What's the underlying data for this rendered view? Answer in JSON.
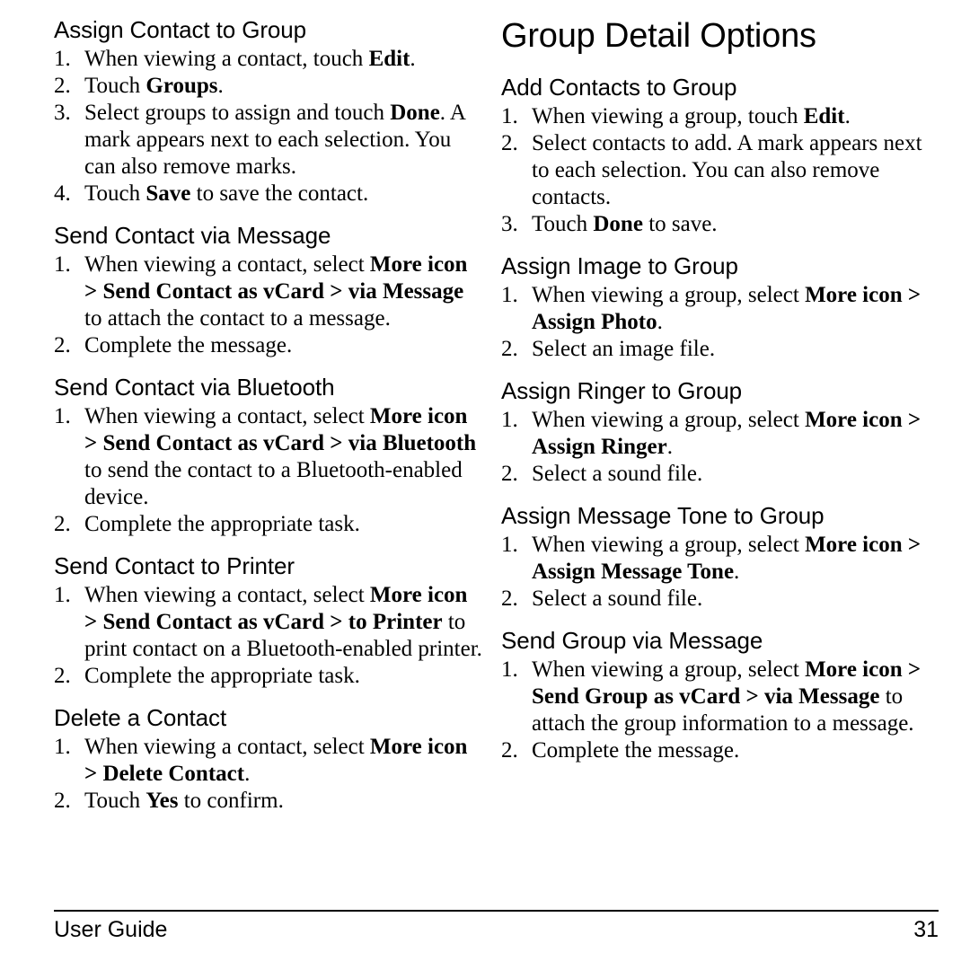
{
  "document": {
    "page_title": "Group Detail Options"
  },
  "left_column": {
    "sections": [
      {
        "heading": "Assign Contact to Group",
        "steps": [
          {
            "num": "1.",
            "parts": [
              {
                "t": "When viewing a contact, touch ",
                "b": false
              },
              {
                "t": "Edit",
                "b": true
              },
              {
                "t": ".",
                "b": false
              }
            ]
          },
          {
            "num": "2.",
            "parts": [
              {
                "t": "Touch ",
                "b": false
              },
              {
                "t": "Groups",
                "b": true
              },
              {
                "t": ".",
                "b": false
              }
            ]
          },
          {
            "num": "3.",
            "parts": [
              {
                "t": "Select groups to assign and touch ",
                "b": false
              },
              {
                "t": "Done",
                "b": true
              },
              {
                "t": ". A mark appears next to each selection. You can also remove marks.",
                "b": false
              }
            ]
          },
          {
            "num": "4.",
            "parts": [
              {
                "t": "Touch ",
                "b": false
              },
              {
                "t": "Save",
                "b": true
              },
              {
                "t": " to save the contact.",
                "b": false
              }
            ]
          }
        ]
      },
      {
        "heading": "Send Contact via Message",
        "steps": [
          {
            "num": "1.",
            "parts": [
              {
                "t": "When viewing a contact, select ",
                "b": false
              },
              {
                "t": "More icon > Send Contact as vCard > via Message",
                "b": true
              },
              {
                "t": " to attach the contact to a message.",
                "b": false
              }
            ]
          },
          {
            "num": "2.",
            "parts": [
              {
                "t": "Complete the message.",
                "b": false
              }
            ]
          }
        ]
      },
      {
        "heading": "Send Contact via Bluetooth",
        "steps": [
          {
            "num": "1.",
            "parts": [
              {
                "t": "When viewing a contact, select ",
                "b": false
              },
              {
                "t": "More icon > Send Contact as vCard > via Bluetooth",
                "b": true
              },
              {
                "t": " to send the contact to a Bluetooth-enabled device.",
                "b": false
              }
            ]
          },
          {
            "num": "2.",
            "parts": [
              {
                "t": "Complete the appropriate task.",
                "b": false
              }
            ]
          }
        ]
      },
      {
        "heading": "Send Contact to Printer",
        "steps": [
          {
            "num": "1.",
            "parts": [
              {
                "t": "When viewing a contact, select ",
                "b": false
              },
              {
                "t": "More icon > Send Contact as vCard > to Printer",
                "b": true
              },
              {
                "t": " to print contact on a Bluetooth-enabled printer.",
                "b": false
              }
            ]
          },
          {
            "num": "2.",
            "parts": [
              {
                "t": "Complete the appropriate task.",
                "b": false
              }
            ]
          }
        ]
      },
      {
        "heading": "Delete a Contact",
        "steps": [
          {
            "num": "1.",
            "parts": [
              {
                "t": "When viewing a contact, select ",
                "b": false
              },
              {
                "t": "More icon > Delete Contact",
                "b": true
              },
              {
                "t": ".",
                "b": false
              }
            ]
          },
          {
            "num": "2.",
            "parts": [
              {
                "t": "Touch ",
                "b": false
              },
              {
                "t": "Yes",
                "b": true
              },
              {
                "t": " to confirm.",
                "b": false
              }
            ]
          }
        ]
      }
    ]
  },
  "right_column": {
    "sections": [
      {
        "heading": "Add Contacts to Group",
        "steps": [
          {
            "num": "1.",
            "parts": [
              {
                "t": "When viewing a group, touch ",
                "b": false
              },
              {
                "t": "Edit",
                "b": true
              },
              {
                "t": ".",
                "b": false
              }
            ]
          },
          {
            "num": "2.",
            "parts": [
              {
                "t": "Select contacts to add. A mark appears next to each selection. You can also remove contacts.",
                "b": false
              }
            ]
          },
          {
            "num": "3.",
            "parts": [
              {
                "t": "Touch ",
                "b": false
              },
              {
                "t": "Done",
                "b": true
              },
              {
                "t": " to save.",
                "b": false
              }
            ]
          }
        ]
      },
      {
        "heading": "Assign Image to Group",
        "steps": [
          {
            "num": "1.",
            "parts": [
              {
                "t": "When viewing a group, select ",
                "b": false
              },
              {
                "t": "More icon > Assign Photo",
                "b": true
              },
              {
                "t": ".",
                "b": false
              }
            ]
          },
          {
            "num": "2.",
            "parts": [
              {
                "t": "Select an image file.",
                "b": false
              }
            ]
          }
        ]
      },
      {
        "heading": "Assign Ringer to Group",
        "steps": [
          {
            "num": "1.",
            "parts": [
              {
                "t": "When viewing a group, select ",
                "b": false
              },
              {
                "t": "More icon > Assign Ringer",
                "b": true
              },
              {
                "t": ".",
                "b": false
              }
            ]
          },
          {
            "num": "2.",
            "parts": [
              {
                "t": "Select a sound file.",
                "b": false
              }
            ]
          }
        ]
      },
      {
        "heading": "Assign Message Tone to Group",
        "steps": [
          {
            "num": "1.",
            "parts": [
              {
                "t": "When viewing a group, select ",
                "b": false
              },
              {
                "t": "More icon > Assign Message Tone",
                "b": true
              },
              {
                "t": ".",
                "b": false
              }
            ]
          },
          {
            "num": "2.",
            "parts": [
              {
                "t": "Select a sound file.",
                "b": false
              }
            ]
          }
        ]
      },
      {
        "heading": "Send Group via Message",
        "steps": [
          {
            "num": "1.",
            "parts": [
              {
                "t": "When viewing a group, select ",
                "b": false
              },
              {
                "t": "More icon > Send Group as vCard > via Message",
                "b": true
              },
              {
                "t": " to attach the group information to a message.",
                "b": false
              }
            ]
          },
          {
            "num": "2.",
            "parts": [
              {
                "t": "Complete the message.",
                "b": false
              }
            ]
          }
        ]
      }
    ]
  },
  "footer": {
    "left_label": "User Guide",
    "page_number": "31"
  }
}
